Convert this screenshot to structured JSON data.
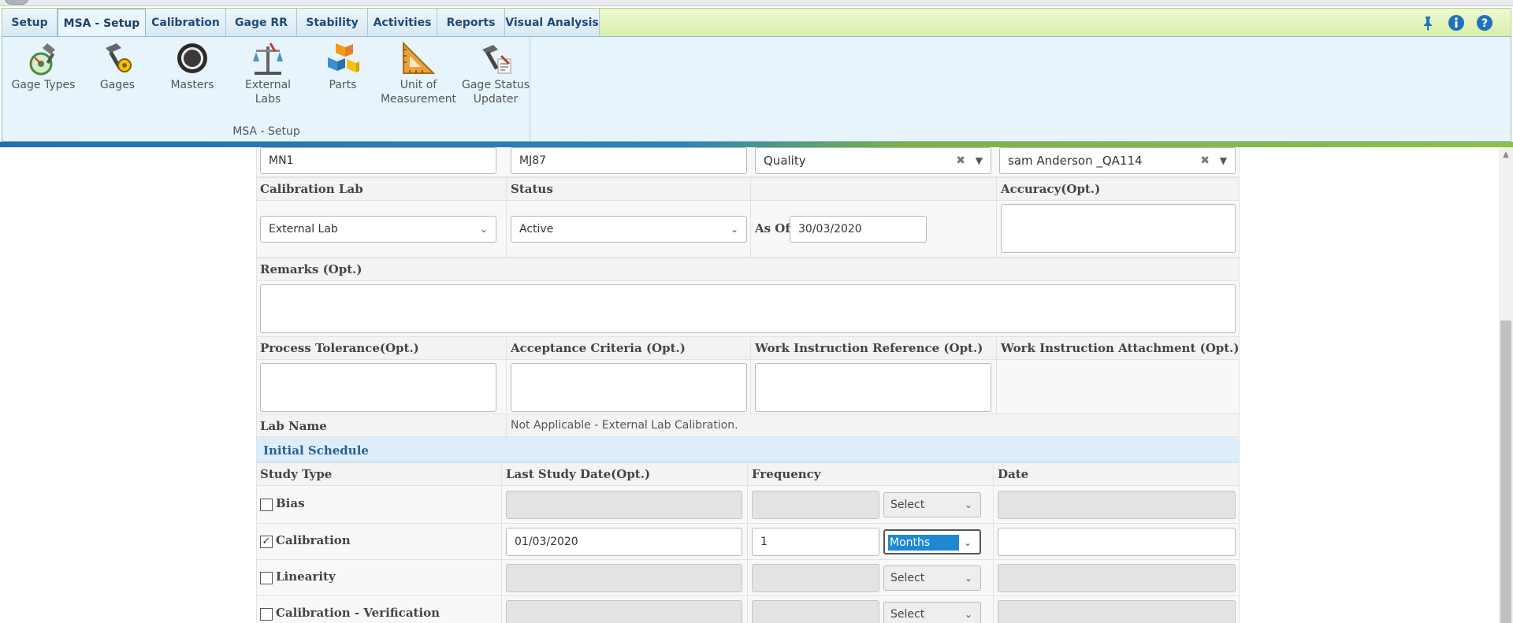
{
  "ribbon": {
    "tabs": [
      {
        "label": "Setup",
        "active": false
      },
      {
        "label": "MSA - Setup",
        "active": true
      },
      {
        "label": "Calibration",
        "active": false
      },
      {
        "label": "Gage RR",
        "active": false
      },
      {
        "label": "Stability",
        "active": false
      },
      {
        "label": "Activities",
        "active": false
      },
      {
        "label": "Reports",
        "active": false
      },
      {
        "label": "Visual Analysis",
        "active": false
      }
    ],
    "icons": [
      "pin-icon",
      "info-icon",
      "help-icon"
    ],
    "buttons": [
      {
        "label": "Gage Types",
        "icon": "gage-types-icon"
      },
      {
        "label": "Gages",
        "icon": "gages-icon"
      },
      {
        "label": "Masters",
        "icon": "masters-icon"
      },
      {
        "label": "External\nLabs",
        "icon": "external-labs-icon"
      },
      {
        "label": "Parts",
        "icon": "parts-icon"
      },
      {
        "label": "Unit of\nMeasurement",
        "icon": "unit-of-measurement-icon"
      },
      {
        "label": "Gage Status\nUpdater",
        "icon": "gage-status-updater-icon"
      }
    ],
    "group_label": "MSA - Setup"
  },
  "form": {
    "top_row": {
      "field1": "MN1",
      "field2": "MJ87",
      "department": "Quality",
      "owner": "sam Anderson _QA114"
    },
    "labels1": {
      "calibration_lab": "Calibration Lab",
      "status": "Status",
      "accuracy": "Accuracy(Opt.)"
    },
    "calibration_lab": "External Lab",
    "status": "Active",
    "as_of_label": "As Of",
    "as_of": "30/03/2020",
    "accuracy": "",
    "remarks_label": "Remarks (Opt.)",
    "remarks": "",
    "labels2": {
      "process_tolerance": "Process Tolerance(Opt.)",
      "acceptance_criteria": "Acceptance Criteria (Opt.)",
      "work_instruction_reference": "Work Instruction Reference (Opt.)",
      "work_instruction_attachment": "Work Instruction Attachment (Opt.)"
    },
    "lab_name_label": "Lab Name",
    "lab_name_value": "Not Applicable - External Lab Calibration.",
    "initial_schedule_title": "Initial Schedule",
    "schedule_headers": {
      "study_type": "Study Type",
      "last_study_date": "Last Study Date(Opt.)",
      "frequency": "Frequency",
      "date": "Date"
    },
    "studies": [
      {
        "name": "Bias",
        "checked": false,
        "last_date": "",
        "frequency": "",
        "unit": "Select",
        "date": ""
      },
      {
        "name": "Calibration",
        "checked": true,
        "last_date": "01/03/2020",
        "frequency": "1",
        "unit": "Months",
        "date": ""
      },
      {
        "name": "Linearity",
        "checked": false,
        "last_date": "",
        "frequency": "",
        "unit": "Select",
        "date": ""
      },
      {
        "name": "Calibration - Verification",
        "checked": false,
        "last_date": "",
        "frequency": "",
        "unit": "Select",
        "date": ""
      }
    ]
  }
}
